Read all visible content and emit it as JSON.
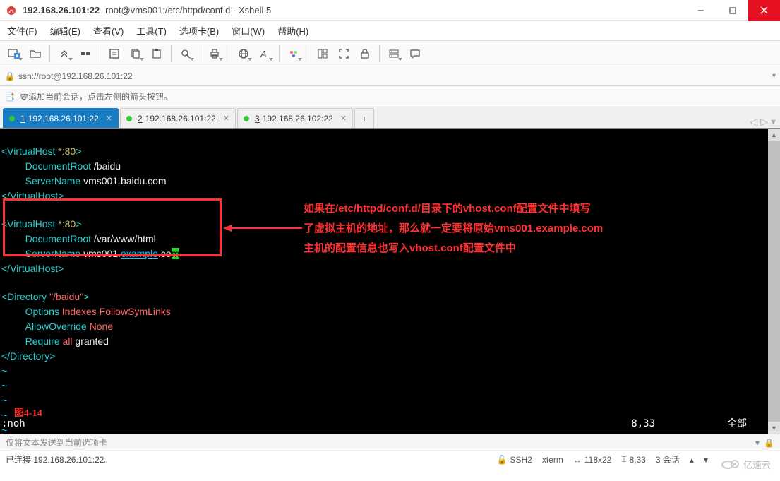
{
  "window": {
    "ip_title": "192.168.26.101:22",
    "path_title": "root@vms001:/etc/httpd/conf.d - Xshell 5"
  },
  "menu": {
    "file": "文件(F)",
    "edit": "编辑(E)",
    "view": "查看(V)",
    "tools": "工具(T)",
    "tabs": "选项卡(B)",
    "window": "窗口(W)",
    "help": "帮助(H)"
  },
  "addressbar": {
    "protocol_label": "ssh://root@192.168.26.101:22"
  },
  "hintbar": {
    "text": "要添加当前会话，点击左侧的箭头按钮。"
  },
  "tabs": [
    {
      "num": "1",
      "label": "192.168.26.101:22",
      "active": true
    },
    {
      "num": "2",
      "label": "192.168.26.101:22",
      "active": false
    },
    {
      "num": "3",
      "label": "192.168.26.102:22",
      "active": false
    }
  ],
  "terminal": {
    "vhost1": {
      "open": "<VirtualHost ",
      "star": "*:80",
      "close_bracket": ">",
      "docroot_key": "DocumentRoot ",
      "docroot_val": "/baidu",
      "servername_key": "ServerName ",
      "servername_val": "vms001.baidu.com",
      "close": "</VirtualHost>"
    },
    "vhost2": {
      "open": "<VirtualHost ",
      "star": "*:80",
      "close_bracket": ">",
      "docroot_key": "DocumentRoot ",
      "docroot_val": "/var/www/html",
      "servername_key": "ServerName ",
      "servername_val_a": "vms001.",
      "servername_val_b": "example",
      "servername_val_c": ".co",
      "servername_cursor": "m",
      "close": "</VirtualHost>"
    },
    "directory": {
      "open": "<Directory ",
      "path": "\"/baidu\"",
      "close_bracket": ">",
      "options_key": "Options ",
      "options_val": "Indexes FollowSymLinks",
      "allow_key": "AllowOverride ",
      "allow_val": "None",
      "require_key": "Require ",
      "require_val1": "all",
      "require_val2": " granted",
      "close": "</Directory>"
    },
    "tilde": "~",
    "figure_label": "图4-14",
    "cmdline": ":noh",
    "pos": "8,33",
    "scroll": "全部"
  },
  "annotation": {
    "line1": "如果在/etc/httpd/conf.d/目录下的vhost.conf配置文件中填写",
    "line2": "了虚拟主机的地址，那么就一定要将原始vms001.example.com",
    "line3": "主机的配置信息也写入vhost.conf配置文件中"
  },
  "sendbar": {
    "placeholder": "仅将文本发送到当前选项卡"
  },
  "statusbar": {
    "connected": "已连接 192.168.26.101:22。",
    "ssh": "SSH2",
    "term": "xterm",
    "size": "118x22",
    "pos": "8,33",
    "sessions": "3 会话"
  },
  "logo": {
    "text": "亿速云"
  }
}
